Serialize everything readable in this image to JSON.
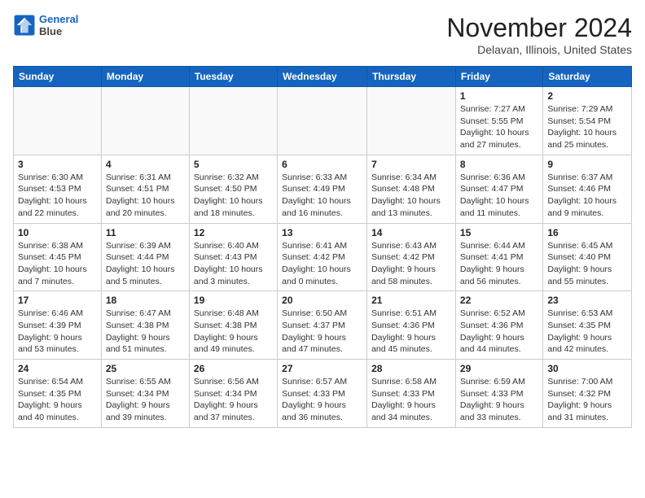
{
  "header": {
    "logo_line1": "General",
    "logo_line2": "Blue",
    "month_title": "November 2024",
    "location": "Delavan, Illinois, United States"
  },
  "days_of_week": [
    "Sunday",
    "Monday",
    "Tuesday",
    "Wednesday",
    "Thursday",
    "Friday",
    "Saturday"
  ],
  "weeks": [
    [
      {
        "day": "",
        "text": "",
        "empty": true
      },
      {
        "day": "",
        "text": "",
        "empty": true
      },
      {
        "day": "",
        "text": "",
        "empty": true
      },
      {
        "day": "",
        "text": "",
        "empty": true
      },
      {
        "day": "",
        "text": "",
        "empty": true
      },
      {
        "day": "1",
        "text": "Sunrise: 7:27 AM\nSunset: 5:55 PM\nDaylight: 10 hours and 27 minutes."
      },
      {
        "day": "2",
        "text": "Sunrise: 7:29 AM\nSunset: 5:54 PM\nDaylight: 10 hours and 25 minutes."
      }
    ],
    [
      {
        "day": "3",
        "text": "Sunrise: 6:30 AM\nSunset: 4:53 PM\nDaylight: 10 hours and 22 minutes."
      },
      {
        "day": "4",
        "text": "Sunrise: 6:31 AM\nSunset: 4:51 PM\nDaylight: 10 hours and 20 minutes."
      },
      {
        "day": "5",
        "text": "Sunrise: 6:32 AM\nSunset: 4:50 PM\nDaylight: 10 hours and 18 minutes."
      },
      {
        "day": "6",
        "text": "Sunrise: 6:33 AM\nSunset: 4:49 PM\nDaylight: 10 hours and 16 minutes."
      },
      {
        "day": "7",
        "text": "Sunrise: 6:34 AM\nSunset: 4:48 PM\nDaylight: 10 hours and 13 minutes."
      },
      {
        "day": "8",
        "text": "Sunrise: 6:36 AM\nSunset: 4:47 PM\nDaylight: 10 hours and 11 minutes."
      },
      {
        "day": "9",
        "text": "Sunrise: 6:37 AM\nSunset: 4:46 PM\nDaylight: 10 hours and 9 minutes."
      }
    ],
    [
      {
        "day": "10",
        "text": "Sunrise: 6:38 AM\nSunset: 4:45 PM\nDaylight: 10 hours and 7 minutes."
      },
      {
        "day": "11",
        "text": "Sunrise: 6:39 AM\nSunset: 4:44 PM\nDaylight: 10 hours and 5 minutes."
      },
      {
        "day": "12",
        "text": "Sunrise: 6:40 AM\nSunset: 4:43 PM\nDaylight: 10 hours and 3 minutes."
      },
      {
        "day": "13",
        "text": "Sunrise: 6:41 AM\nSunset: 4:42 PM\nDaylight: 10 hours and 0 minutes."
      },
      {
        "day": "14",
        "text": "Sunrise: 6:43 AM\nSunset: 4:42 PM\nDaylight: 9 hours and 58 minutes."
      },
      {
        "day": "15",
        "text": "Sunrise: 6:44 AM\nSunset: 4:41 PM\nDaylight: 9 hours and 56 minutes."
      },
      {
        "day": "16",
        "text": "Sunrise: 6:45 AM\nSunset: 4:40 PM\nDaylight: 9 hours and 55 minutes."
      }
    ],
    [
      {
        "day": "17",
        "text": "Sunrise: 6:46 AM\nSunset: 4:39 PM\nDaylight: 9 hours and 53 minutes."
      },
      {
        "day": "18",
        "text": "Sunrise: 6:47 AM\nSunset: 4:38 PM\nDaylight: 9 hours and 51 minutes."
      },
      {
        "day": "19",
        "text": "Sunrise: 6:48 AM\nSunset: 4:38 PM\nDaylight: 9 hours and 49 minutes."
      },
      {
        "day": "20",
        "text": "Sunrise: 6:50 AM\nSunset: 4:37 PM\nDaylight: 9 hours and 47 minutes."
      },
      {
        "day": "21",
        "text": "Sunrise: 6:51 AM\nSunset: 4:36 PM\nDaylight: 9 hours and 45 minutes."
      },
      {
        "day": "22",
        "text": "Sunrise: 6:52 AM\nSunset: 4:36 PM\nDaylight: 9 hours and 44 minutes."
      },
      {
        "day": "23",
        "text": "Sunrise: 6:53 AM\nSunset: 4:35 PM\nDaylight: 9 hours and 42 minutes."
      }
    ],
    [
      {
        "day": "24",
        "text": "Sunrise: 6:54 AM\nSunset: 4:35 PM\nDaylight: 9 hours and 40 minutes."
      },
      {
        "day": "25",
        "text": "Sunrise: 6:55 AM\nSunset: 4:34 PM\nDaylight: 9 hours and 39 minutes."
      },
      {
        "day": "26",
        "text": "Sunrise: 6:56 AM\nSunset: 4:34 PM\nDaylight: 9 hours and 37 minutes."
      },
      {
        "day": "27",
        "text": "Sunrise: 6:57 AM\nSunset: 4:33 PM\nDaylight: 9 hours and 36 minutes."
      },
      {
        "day": "28",
        "text": "Sunrise: 6:58 AM\nSunset: 4:33 PM\nDaylight: 9 hours and 34 minutes."
      },
      {
        "day": "29",
        "text": "Sunrise: 6:59 AM\nSunset: 4:33 PM\nDaylight: 9 hours and 33 minutes."
      },
      {
        "day": "30",
        "text": "Sunrise: 7:00 AM\nSunset: 4:32 PM\nDaylight: 9 hours and 31 minutes."
      }
    ]
  ]
}
